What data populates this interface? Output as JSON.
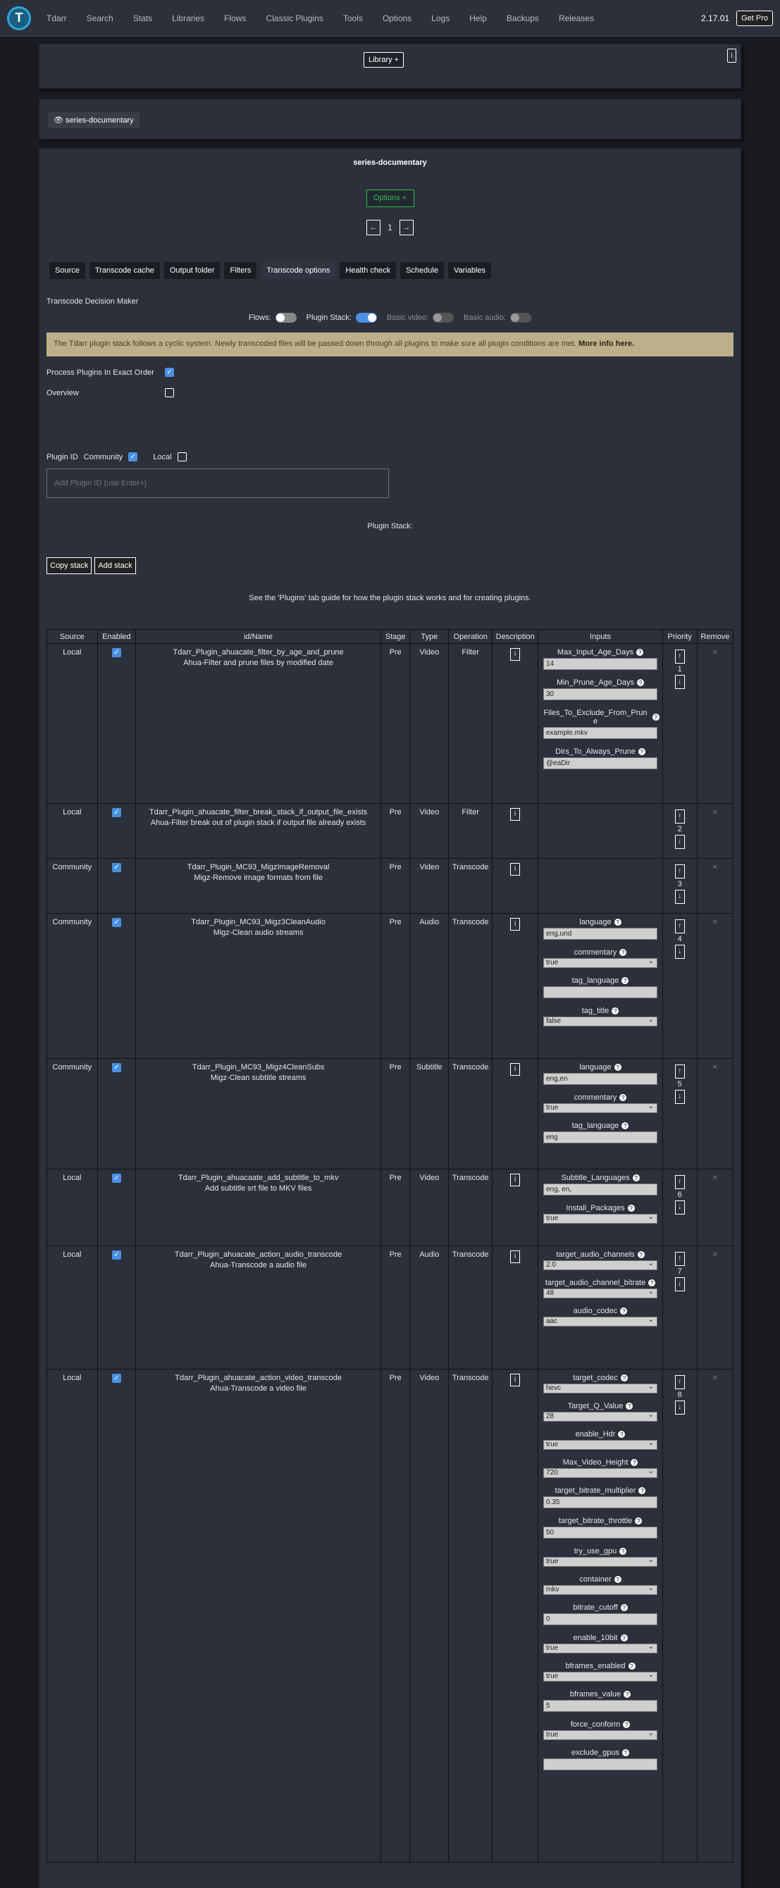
{
  "nav": {
    "items": [
      "Tdarr",
      "Search",
      "Stats",
      "Libraries",
      "Flows",
      "Classic Plugins",
      "Tools",
      "Options",
      "Logs",
      "Help",
      "Backups",
      "Releases"
    ],
    "version": "2.17.01",
    "get_pro": "Get Pro"
  },
  "library": {
    "button": "Library +",
    "info": "i",
    "chip": "series-documentary"
  },
  "main": {
    "title": "series-documentary",
    "options_btn": "Options +",
    "pager": [
      "←",
      "1",
      "→"
    ],
    "tabs": [
      "Source",
      "Transcode cache",
      "Output folder",
      "Filters",
      "Transcode options",
      "Health check",
      "Schedule",
      "Variables"
    ],
    "tdm": "Transcode Decision Maker",
    "toggles": {
      "flows": "Flows:",
      "plugin_stack": "Plugin Stack:",
      "basic_video": "Basic video:",
      "basic_audio": "Basic audio:"
    },
    "banner": "The Tdarr plugin stack follows a cyclic system. Newly transcoded files will be passed down through all plugins to make sure all plugin conditions are met.",
    "banner_link": "More info here.",
    "process_exact": "Process Plugins In Exact Order",
    "overview": "Overview",
    "plugin_id": "Plugin ID",
    "community": "Community",
    "local": "Local",
    "add_placeholder": "Add Plugin ID (use Enter+)",
    "plugin_stack_label": "Plugin Stack:",
    "copy_stack": "Copy stack",
    "add_stack": "Add stack",
    "guide": "See the 'Plugins' tab guide for how the plugin stack works and for creating plugins."
  },
  "table": {
    "headers": [
      "Source",
      "Enabled",
      "id/Name",
      "Stage",
      "Type",
      "Operation",
      "Description",
      "Inputs",
      "Priority",
      "Remove"
    ],
    "rows": [
      {
        "source": "Local",
        "id": "Tdarr_Plugin_ahuacate_filter_by_age_and_prune",
        "name": "Ahua-Filter and prune files by modified date",
        "stage": "Pre",
        "type": "Video",
        "op": "Filter",
        "priority": "1",
        "inputs": [
          {
            "l": "Max_Input_Age_Days",
            "v": "14",
            "t": "i"
          },
          {
            "l": "Min_Prune_Age_Days",
            "v": "30",
            "t": "i"
          },
          {
            "l": "Files_To_Exclude_From_Prune",
            "v": "example.mkv",
            "t": "i"
          },
          {
            "l": "Dirs_To_Always_Prune",
            "v": "@eaDir",
            "t": "i"
          }
        ]
      },
      {
        "source": "Local",
        "id": "Tdarr_Plugin_ahuacate_filter_break_stack_if_output_file_exists",
        "name": "Ahua-Filter break out of plugin stack if output file already exists",
        "stage": "Pre",
        "type": "Video",
        "op": "Filter",
        "priority": "2",
        "inputs": []
      },
      {
        "source": "Community",
        "id": "Tdarr_Plugin_MC93_MigzImageRemoval",
        "name": "Migz-Remove image formats from file",
        "stage": "Pre",
        "type": "Video",
        "op": "Transcode",
        "priority": "3",
        "inputs": []
      },
      {
        "source": "Community",
        "id": "Tdarr_Plugin_MC93_Migz3CleanAudio",
        "name": "Migz-Clean audio streams",
        "stage": "Pre",
        "type": "Audio",
        "op": "Transcode",
        "priority": "4",
        "inputs": [
          {
            "l": "language",
            "v": "eng,und",
            "t": "i"
          },
          {
            "l": "commentary",
            "v": "true",
            "t": "s"
          },
          {
            "l": "tag_language",
            "v": "",
            "t": "i"
          },
          {
            "l": "tag_title",
            "v": "false",
            "t": "s"
          }
        ]
      },
      {
        "source": "Community",
        "id": "Tdarr_Plugin_MC93_Migz4CleanSubs",
        "name": "Migz-Clean subtitle streams",
        "stage": "Pre",
        "type": "Subtitle",
        "op": "Transcode",
        "priority": "5",
        "inputs": [
          {
            "l": "language",
            "v": "eng,en",
            "t": "i"
          },
          {
            "l": "commentary",
            "v": "true",
            "t": "s"
          },
          {
            "l": "tag_language",
            "v": "eng",
            "t": "i"
          }
        ]
      },
      {
        "source": "Local",
        "id": "Tdarr_Plugin_ahuacaate_add_subtitle_to_mkv",
        "name": "Add subtitle srt file to MKV files",
        "stage": "Pre",
        "type": "Video",
        "op": "Transcode",
        "priority": "6",
        "inputs": [
          {
            "l": "Subtitle_Languages",
            "v": "eng, en,",
            "t": "i"
          },
          {
            "l": "Install_Packages",
            "v": "true",
            "t": "s"
          }
        ]
      },
      {
        "source": "Local",
        "id": "Tdarr_Plugin_ahuacate_action_audio_transcode",
        "name": "Ahua-Transcode a audio file",
        "stage": "Pre",
        "type": "Audio",
        "op": "Transcode",
        "priority": "7",
        "inputs": [
          {
            "l": "target_audio_channels",
            "v": "2.0",
            "t": "s"
          },
          {
            "l": "target_audio_channel_bitrate",
            "v": "48",
            "t": "s"
          },
          {
            "l": "audio_codec",
            "v": "aac",
            "t": "s"
          }
        ]
      },
      {
        "source": "Local",
        "id": "Tdarr_Plugin_ahuacate_action_video_transcode",
        "name": "Ahua-Transcode a video file",
        "stage": "Pre",
        "type": "Video",
        "op": "Transcode",
        "priority": "8",
        "inputs": [
          {
            "l": "target_codec",
            "v": "hevc",
            "t": "s"
          },
          {
            "l": "Target_Q_Value",
            "v": "28",
            "t": "s"
          },
          {
            "l": "enable_Hdr",
            "v": "true",
            "t": "s"
          },
          {
            "l": "Max_Video_Height",
            "v": "720",
            "t": "s"
          },
          {
            "l": "target_bitrate_multiplier",
            "v": "0.35",
            "t": "i"
          },
          {
            "l": "target_bitrate_throttle",
            "v": "50",
            "t": "i"
          },
          {
            "l": "try_use_gpu",
            "v": "true",
            "t": "s"
          },
          {
            "l": "container",
            "v": "mkv",
            "t": "s"
          },
          {
            "l": "bitrate_cutoff",
            "v": "0",
            "t": "i"
          },
          {
            "l": "enable_10bit",
            "v": "true",
            "t": "s"
          },
          {
            "l": "bframes_enabled",
            "v": "true",
            "t": "s"
          },
          {
            "l": "bframes_value",
            "v": "5",
            "t": "i"
          },
          {
            "l": "force_conform",
            "v": "true",
            "t": "s"
          },
          {
            "l": "exclude_gpus",
            "v": "",
            "t": "i"
          }
        ]
      }
    ]
  }
}
